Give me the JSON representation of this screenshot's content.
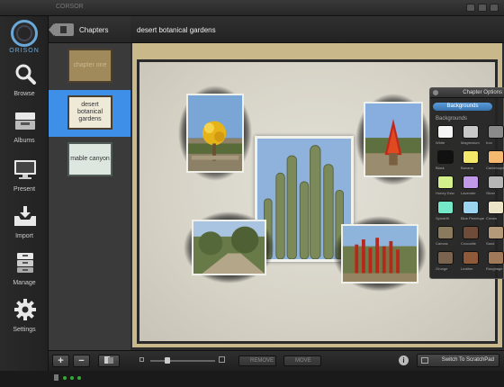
{
  "window": {
    "title": "CORSOR"
  },
  "app": {
    "logo_text": "ORISON"
  },
  "nav": {
    "items": [
      {
        "label": "Browse",
        "icon": "magnifier-icon"
      },
      {
        "label": "Albums",
        "icon": "tray-icon"
      },
      {
        "label": "Present",
        "icon": "monitor-icon"
      },
      {
        "label": "Import",
        "icon": "inbox-download-icon"
      },
      {
        "label": "Manage",
        "icon": "file-cabinet-icon"
      },
      {
        "label": "Settings",
        "icon": "gear-icon"
      }
    ]
  },
  "chapters": {
    "header": "Chapters",
    "items": [
      {
        "label": "chapter one",
        "selected": false
      },
      {
        "label": "desert botanical gardens",
        "selected": true
      },
      {
        "label": "mable canyon",
        "selected": false
      }
    ]
  },
  "document": {
    "title": "desert botanical gardens"
  },
  "chapter_options": {
    "title": "Chapter Options",
    "tab": "Backgrounds",
    "section": "Backgrounds",
    "swatches": [
      {
        "label": "White",
        "color": "#f4f4f4"
      },
      {
        "label": "Magnesium",
        "color": "#c8c8c8"
      },
      {
        "label": "Iron",
        "color": "#8a8a8a"
      },
      {
        "label": "Black",
        "color": "#111111"
      },
      {
        "label": "Banana",
        "color": "#f4e86a"
      },
      {
        "label": "Canteloupe",
        "color": "#f5b870"
      },
      {
        "label": "Honey Dew",
        "color": "#d4f08a"
      },
      {
        "label": "Lavender",
        "color": "#c09ae8"
      },
      {
        "label": "Silver",
        "color": "#b6b6b6"
      },
      {
        "label": "Spindrift",
        "color": "#74e8c8"
      },
      {
        "label": "Blue Penelope",
        "color": "#9ad4ee"
      },
      {
        "label": "Cream",
        "color": "#ece4c6"
      },
      {
        "label": "Canvas",
        "color": "#8a7a5e"
      },
      {
        "label": "Crocodile",
        "color": "#6f4b3a"
      },
      {
        "label": "Sand",
        "color": "#b49a78"
      },
      {
        "label": "Grunge",
        "color": "#7a6450"
      },
      {
        "label": "Leather",
        "color": "#8e5a3a"
      },
      {
        "label": "Roughage",
        "color": "#a07a58"
      }
    ]
  },
  "toolbar": {
    "add_label": "+",
    "remove_chapter_label": "−",
    "remove_label": "REMOVE",
    "move_label": "MOVE",
    "info_label": "i",
    "scratchpad_label": "Switch To ScratchPad"
  },
  "colors": {
    "accent": "#3d8fe8",
    "frame": "#c9b98a",
    "logo": "#6aa8d8"
  }
}
